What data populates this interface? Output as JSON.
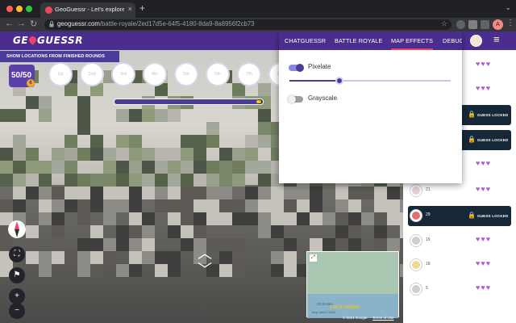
{
  "browser": {
    "tab_title": "GeoGuessr - Let's explore the",
    "tab_close": "×",
    "new_tab": "+",
    "url_host": "geoguessr.com",
    "url_path": "/battle-royale/2ed17d5e-64f5-4180-8da9-8a8956f2cb73",
    "profile_initial": "A"
  },
  "game": {
    "logo_left": "GE",
    "logo_right": "GUESSR",
    "show_locations_label": "SHOW LOCATIONS FROM FINISHED ROUNDS",
    "lives": "50/50",
    "lives_badge": "6",
    "rounds": [
      "1st",
      "2nd",
      "3rd",
      "4th",
      "5th",
      "6th",
      "7th",
      "8th"
    ],
    "progress_fraction": 0.97,
    "minimap": {
      "ocean_label": "OCEANIA",
      "map_data": "Map data ©2021",
      "lock_guess": "LOCK GUESS",
      "attribution": "© 2021 Google",
      "terms": "Terms of Use"
    },
    "controls": {
      "fullscreen": "⛶",
      "flag": "⚑",
      "zoom_in": "+",
      "zoom_out": "−"
    },
    "move_chevrons": "︿"
  },
  "popup": {
    "tabs": [
      "CHATGUESSR",
      "BATTLE ROYALE",
      "MAP EFFECTS",
      "DEBUG"
    ],
    "active_tab": "MAP EFFECTS",
    "pixelate": {
      "label": "Pixelate",
      "enabled": true,
      "amount_fraction": 0.31
    },
    "grayscale": {
      "label": "Grayscale",
      "enabled": false
    }
  },
  "players": [
    {
      "score": "",
      "hearts": "♥♥♥",
      "locked": false,
      "color": "#d9d9d9"
    },
    {
      "score": "",
      "hearts": "♥♥♥",
      "locked": false,
      "color": "#d9d9d9"
    },
    {
      "score": "",
      "hearts": "",
      "locked": true,
      "lock_label": "GUESS LOCKED",
      "color": "#2a3d52"
    },
    {
      "score": "",
      "hearts": "",
      "locked": true,
      "lock_label": "GUESS LOCKED",
      "color": "#2a3d52"
    },
    {
      "score": "",
      "hearts": "♥♥♥",
      "locked": false,
      "color": "#d9d9d9"
    },
    {
      "score": "21",
      "hearts": "♥♥♥",
      "locked": false,
      "color": "#e7cfcf"
    },
    {
      "score": "29",
      "hearts": "",
      "locked": true,
      "lock_label": "GUESS LOCKED",
      "color": "#e36f6f"
    },
    {
      "score": "19",
      "hearts": "♥♥♥",
      "locked": false,
      "color": "#cfcfcf"
    },
    {
      "score": "18",
      "hearts": "♥♥♥",
      "locked": false,
      "color": "#f0d98c"
    },
    {
      "score": "5",
      "hearts": "♥♥♥",
      "locked": false,
      "color": "#cfcfcf"
    }
  ],
  "colors": {
    "brand_purple": "#4b2d8f",
    "accent_red": "#e94560",
    "heart": "#b25ad6",
    "lock_gold": "#f5a623"
  }
}
